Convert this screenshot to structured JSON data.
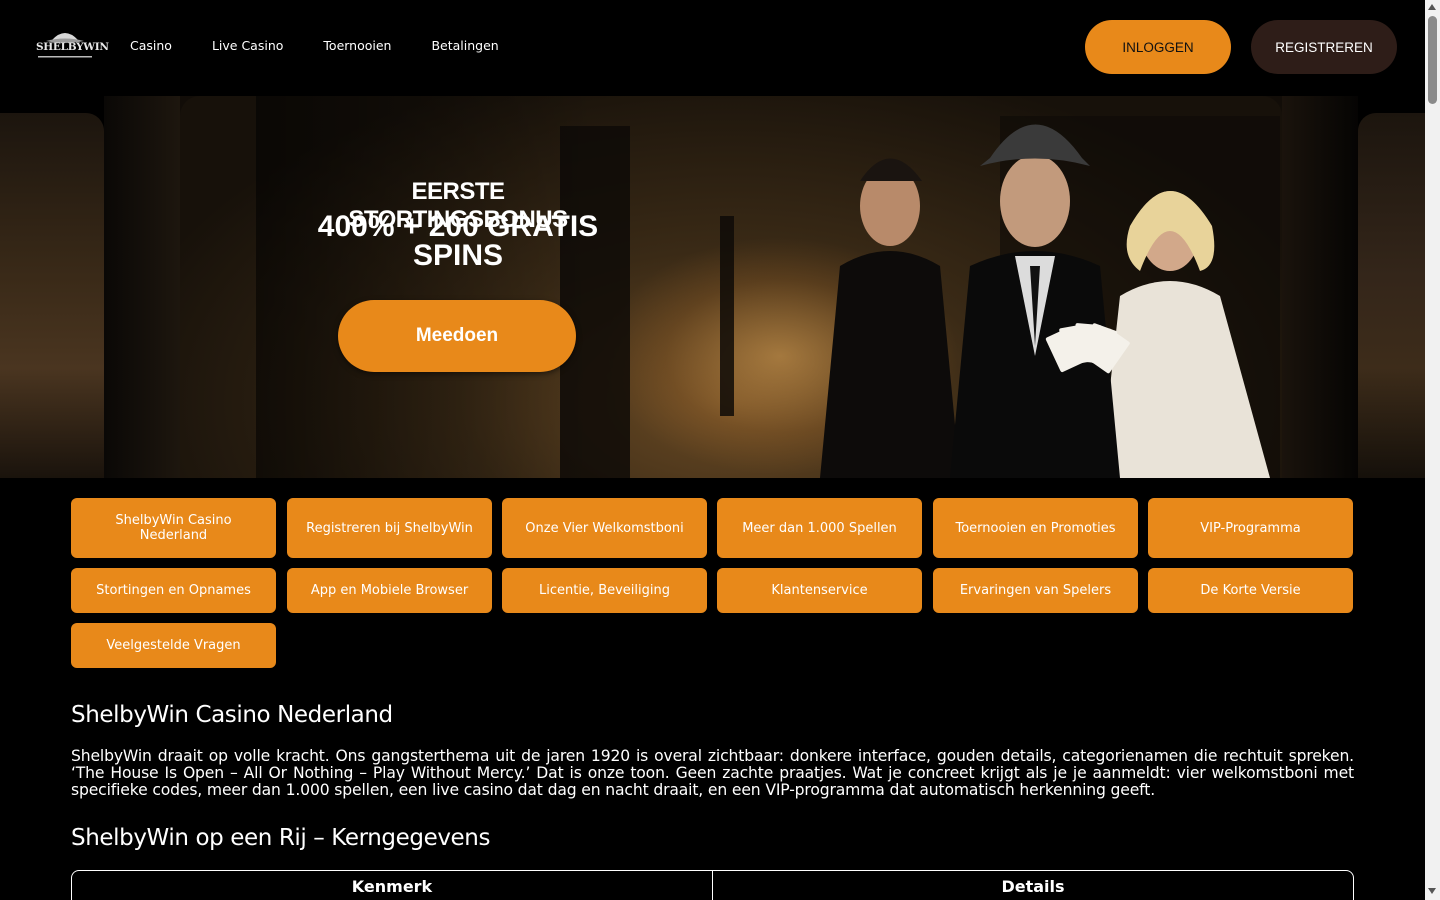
{
  "header": {
    "logo_text": "SHELBYWIN",
    "nav": [
      "Casino",
      "Live Casino",
      "Toernooien",
      "Betalingen"
    ],
    "login_label": "INLOGGEN",
    "register_label": "REGISTREREN"
  },
  "hero": {
    "eyebrow": "EERSTE STORTINGSBONUS",
    "title": "400% + 200 GRATIS SPINS",
    "cta_label": "Meedoen"
  },
  "toc": [
    "ShelbyWin Casino Nederland",
    "Registreren bij ShelbyWin",
    "Onze Vier Welkomstboni",
    "Meer dan 1.000 Spellen",
    "Toernooien en Promoties",
    "VIP-Programma",
    "Stortingen en Opnames",
    "App en Mobiele Browser",
    "Licentie, Beveiliging",
    "Klantenservice",
    "Ervaringen van Spelers",
    "De Korte Versie",
    "Veelgestelde Vragen"
  ],
  "content": {
    "heading1": "ShelbyWin Casino Nederland",
    "paragraph1": "ShelbyWin draait op volle kracht. Ons gangsterthema uit de jaren 1920 is overal zichtbaar: donkere interface, gouden details, categorienamen die rechtuit spreken. ‘The House Is Open – All Or Nothing – Play Without Mercy.’ Dat is onze toon. Geen zachte praatjes. Wat je concreet krijgt als je je aanmeldt: vier welkomstboni met specifieke codes, meer dan 1.000 spellen, een live casino dat dag en nacht draait, en een VIP-programma dat automatisch herkenning geeft.",
    "heading2": "ShelbyWin op een Rij – Kerngegevens",
    "table_headers": [
      "Kenmerk",
      "Details"
    ]
  },
  "colors": {
    "accent": "#e8891a",
    "register_bg": "#2e1d18",
    "background": "#000000"
  }
}
